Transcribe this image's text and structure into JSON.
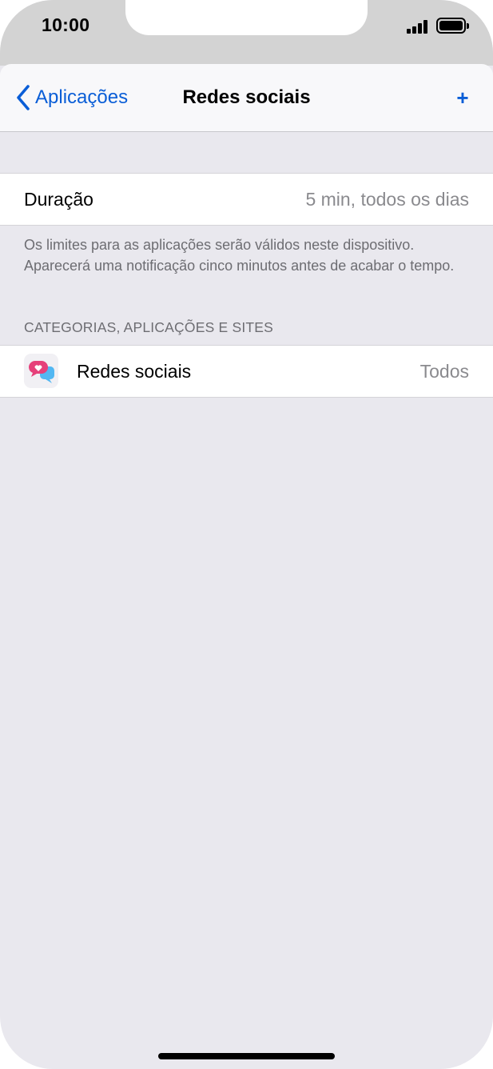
{
  "status_bar": {
    "time": "10:00",
    "icons": [
      "signal-icon",
      "battery-icon"
    ]
  },
  "nav": {
    "back_label": "Aplicações",
    "title": "Redes sociais",
    "add_label": "+",
    "accent_color": "#0a5ed7"
  },
  "duration": {
    "label": "Duração",
    "value": "5 min, todos os dias"
  },
  "footer_note": "Os limites para as aplicações serão válidos neste dispositivo. Aparecerá uma notificação cinco minutos antes de acabar o tempo.",
  "section": {
    "header": "CATEGORIAS, APLICAÇÕES E SITES",
    "items": [
      {
        "icon": "social-networking-icon",
        "label": "Redes sociais",
        "value": "Todos"
      }
    ]
  }
}
